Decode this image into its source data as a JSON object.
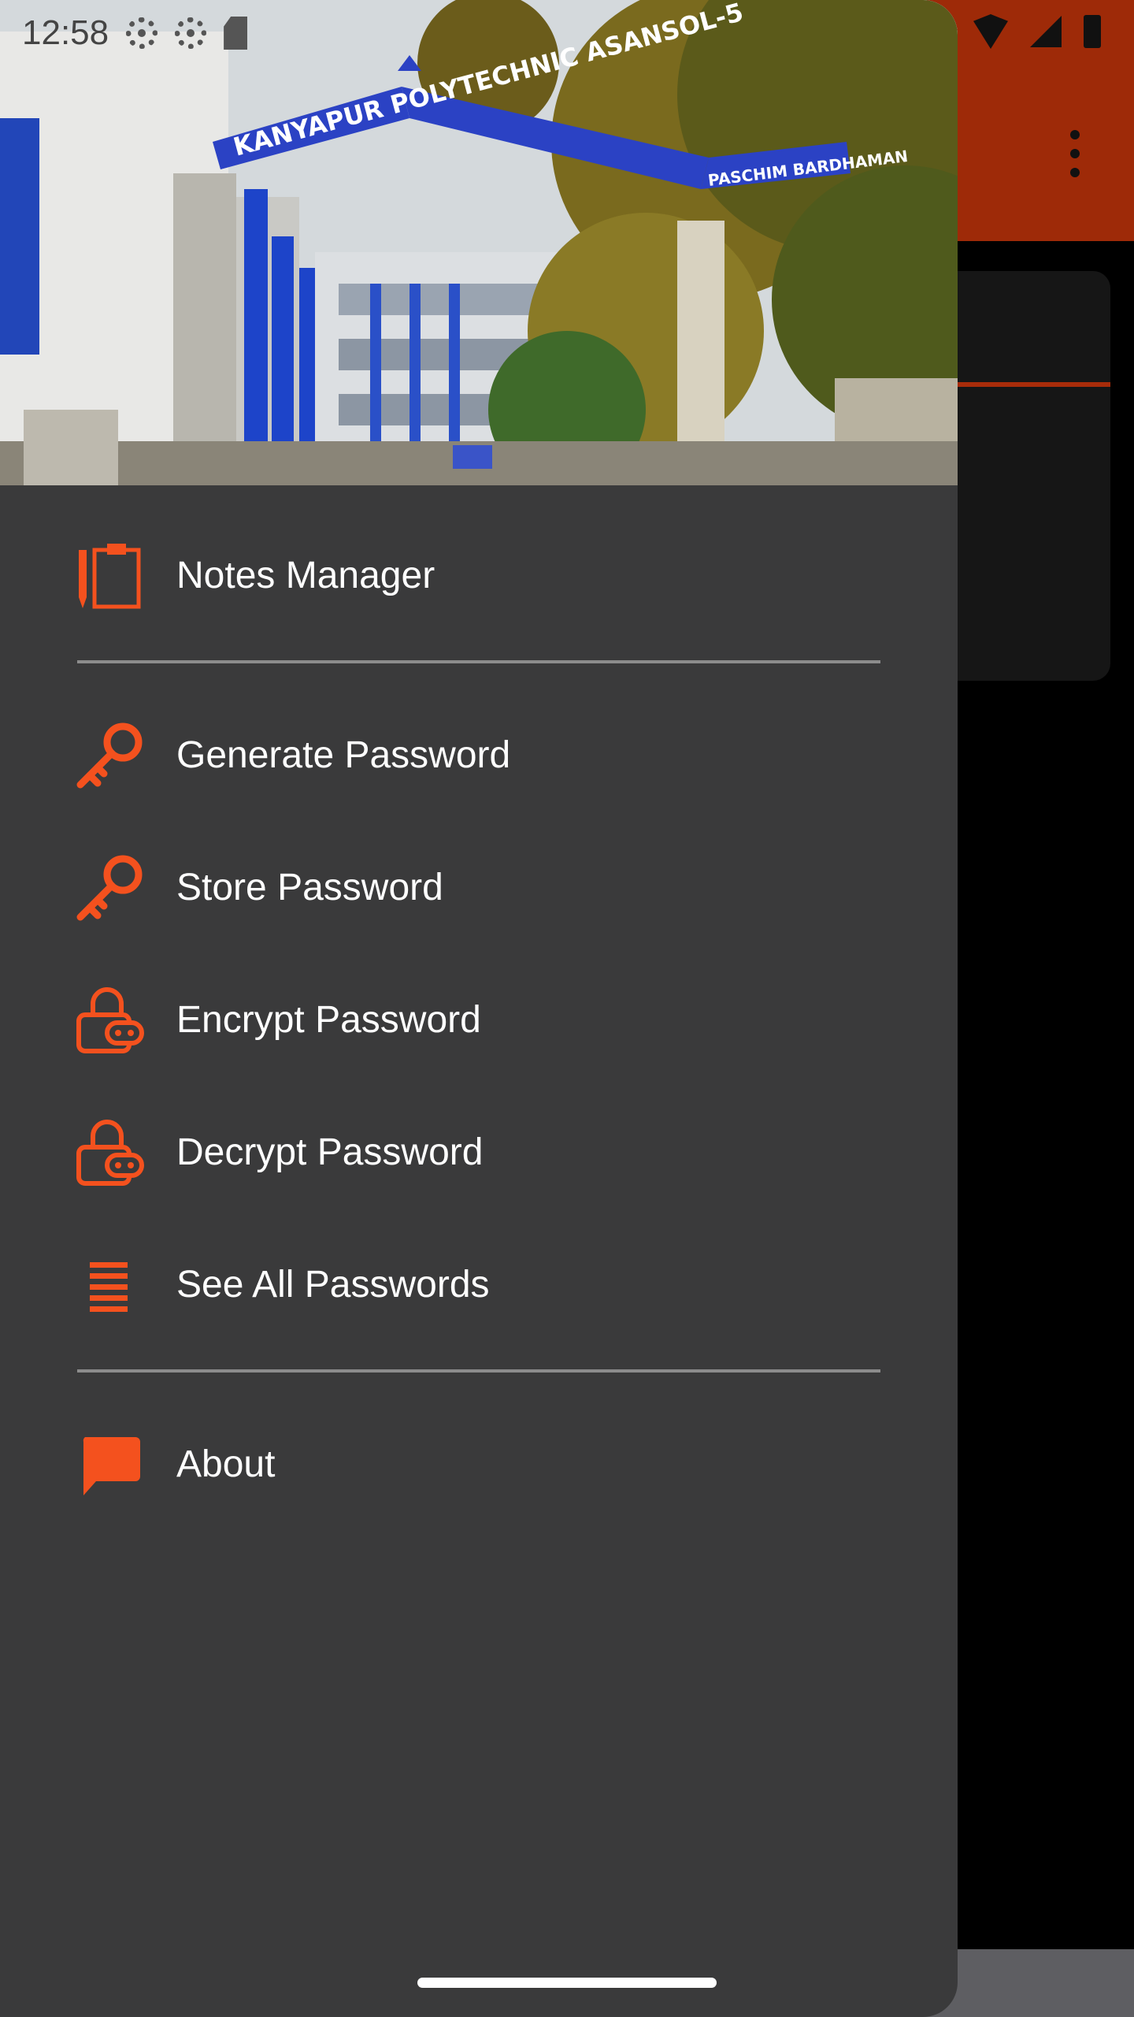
{
  "status_bar": {
    "time": "12:58"
  },
  "drawer": {
    "header_image": "Kanyapur Polytechnic Asansol-5 gate photo",
    "header_sign_text": "KANYAPUR POLYTECHNIC ASANSOL-5",
    "header_sign_sub": "PASCHIM BARDHAMAN",
    "items": [
      {
        "label": "Notes Manager",
        "icon": "clipboard-pencil-icon"
      },
      {
        "label": "Generate Password",
        "icon": "key-icon"
      },
      {
        "label": "Store Password",
        "icon": "key-icon"
      },
      {
        "label": "Encrypt Password",
        "icon": "lock-icon"
      },
      {
        "label": "Decrypt Password",
        "icon": "lock-icon"
      },
      {
        "label": "See All Passwords",
        "icon": "list-icon"
      },
      {
        "label": "About",
        "icon": "chat-bubble-icon"
      }
    ]
  },
  "colors": {
    "accent": "#f4511e",
    "drawer_background": "#3a3a3b",
    "toolbar": "#9e2a08",
    "text": "#ffffff",
    "divider": "#8c8c8c"
  }
}
